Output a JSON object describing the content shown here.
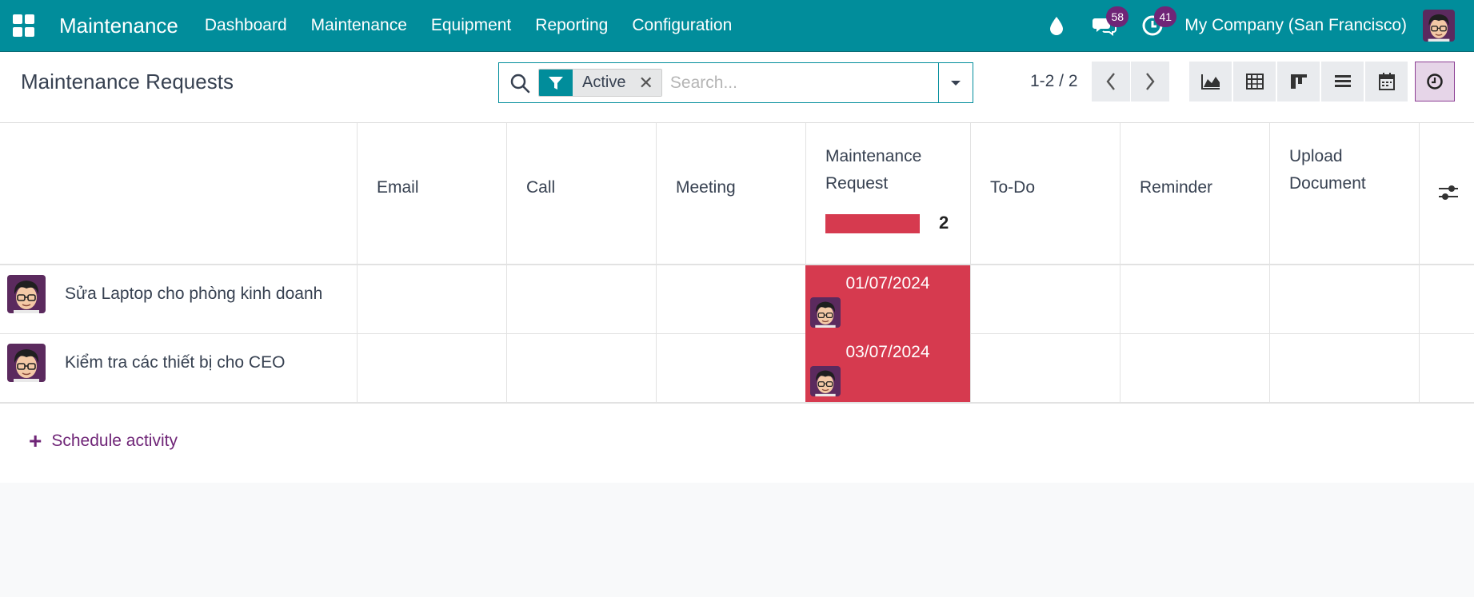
{
  "navbar": {
    "app_title": "Maintenance",
    "menu": [
      "Dashboard",
      "Maintenance",
      "Equipment",
      "Reporting",
      "Configuration"
    ],
    "messages_count": "58",
    "activities_count": "41",
    "company": "My Company (San Francisco)"
  },
  "control_panel": {
    "title": "Maintenance Requests",
    "facet_value": "Active",
    "search_placeholder": "Search...",
    "pager": "1-2 / 2"
  },
  "table": {
    "columns": [
      {
        "label": "Email"
      },
      {
        "label": "Call"
      },
      {
        "label": "Meeting"
      },
      {
        "label": "Maintenance Request",
        "count": "2"
      },
      {
        "label": "To-Do"
      },
      {
        "label": "Reminder"
      },
      {
        "label": "Upload Document"
      }
    ],
    "rows": [
      {
        "name": "Sửa Laptop cho phòng kinh doanh",
        "date": "01/07/2024"
      },
      {
        "name": "Kiểm tra các thiết bị cho CEO",
        "date": "03/07/2024"
      }
    ]
  },
  "schedule_label": "Schedule activity",
  "colors": {
    "navbar": "#018d9b",
    "overdue": "#d63a4f",
    "accent": "#6f2577"
  }
}
